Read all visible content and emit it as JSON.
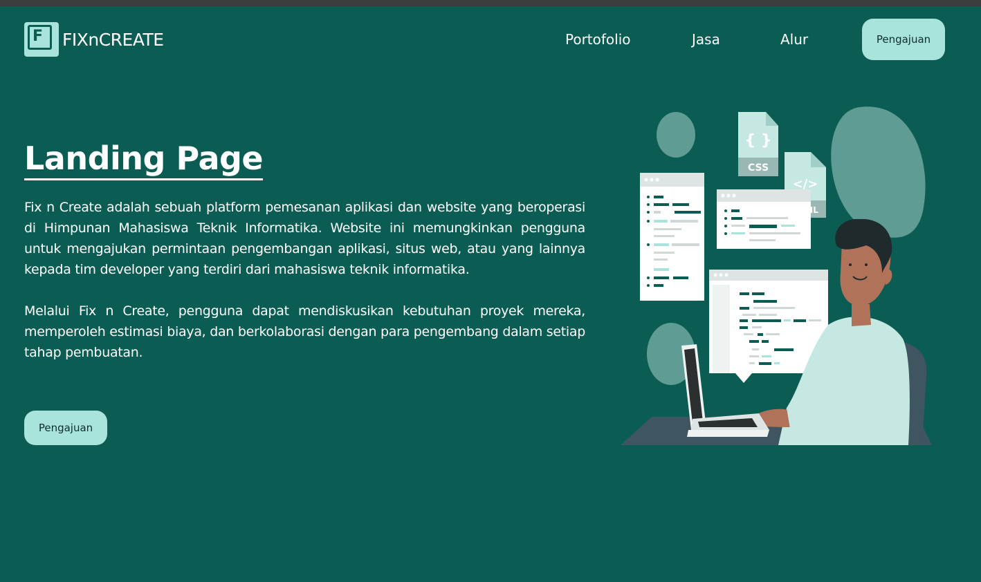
{
  "brand": {
    "logo_letter": "F",
    "name": "FIXnCREATE"
  },
  "nav": {
    "items": [
      "Portofolio",
      "Jasa",
      "Alur"
    ],
    "cta_label": "Pengajuan"
  },
  "hero": {
    "title": "Landing Page",
    "paragraphs": [
      "Fix n Create adalah sebuah platform pemesanan aplikasi dan website yang beroperasi di Himpunan Mahasiswa Teknik Informatika. Website ini memungkinkan pengguna untuk mengajukan permintaan pengembangan aplikasi, situs web, atau yang lainnya kepada tim developer yang terdiri dari mahasiswa teknik informatika.",
      "Melalui Fix n Create, pengguna dapat mendiskusikan kebutuhan proyek mereka, memperoleh estimasi biaya, dan berkolaborasi dengan para pengembang dalam setiap tahap pembuatan."
    ],
    "cta_label": "Pengajuan"
  },
  "illustration": {
    "file_labels": [
      "CSS",
      "HTML"
    ],
    "code_glyphs": [
      "{ }",
      "</>"
    ]
  },
  "colors": {
    "background": "#0b5d54",
    "accent": "#a8e3dc",
    "topbar": "#3a3d3c"
  }
}
